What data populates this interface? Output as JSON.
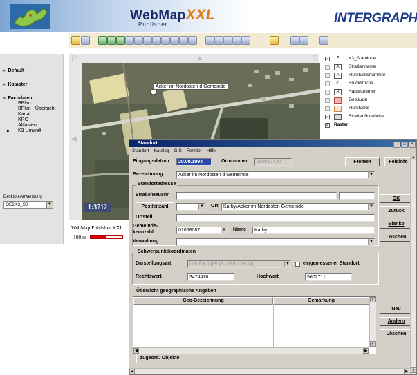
{
  "banner": {
    "product_name": "WebMap",
    "product_suffix": "XXL",
    "product_sub": "Publisher",
    "company": "INTERGRAPH"
  },
  "left_panel": {
    "groups": [
      "Default",
      "Kataster",
      "Fachdaten"
    ],
    "fachdaten_items": [
      "BPlan",
      "BPlan - Übersicht",
      "Kanal",
      "KRO",
      "Altlasten",
      "K3 Umwelt"
    ],
    "desktop_label": "Desktop-Anwendung",
    "desktop_value": "OE2K3_S0"
  },
  "map": {
    "callout": "Acker im Nordosten d Gemeinde",
    "scale": "1:3712",
    "footer": "WebMap Publisher XXL",
    "distance": "100 m"
  },
  "legend": {
    "items": [
      {
        "label": "K3_Standorte",
        "checked": true
      },
      {
        "label": "Straßenname",
        "checked": false
      },
      {
        "label": "Flurstücksnummer",
        "checked": false
      },
      {
        "label": "Bruckstriche",
        "checked": false
      },
      {
        "label": "Hausnummer",
        "checked": false
      },
      {
        "label": "Gebäude",
        "checked": false
      },
      {
        "label": "Flurstücke",
        "checked": false
      },
      {
        "label": "Straßenflurstücke",
        "checked": true
      },
      {
        "label": "Raster",
        "checked": true
      }
    ]
  },
  "dialog": {
    "title": "Standort",
    "menu": [
      "Standort",
      "Katalog",
      "GIS",
      "Fenster",
      "Hilfe"
    ],
    "eingangsdatum_label": "Eingangsdatum",
    "eingangsdatum": "20.09.1994",
    "ortnummer_label": "Ortnummer",
    "ortnummer": "990017420",
    "freitext_button": "Freitext",
    "feldinfo_button": "Feldinfo",
    "bezeichnung_label": "Bezeichnung",
    "bezeichnung": "Acker im Nordosten d Gemeinde",
    "standortadresse_title": "Standortadresse",
    "strasse_label": "Straße/Hausnr",
    "strasse": "",
    "postleitzahl_button": "Postleitzahl",
    "ort_label": "Ort",
    "ort": "Karby/Acker im Nordosten Gemeinde",
    "ortsteil_label": "Ortsteil",
    "ortsteil": "",
    "gemeindekennzahl_label_1": "Gemeinde-",
    "gemeindekennzahl_label_2": "kennzahl",
    "gemeindekennzahl": "01058087",
    "name_label": "Name",
    "name": "Karby",
    "verwaltung_label": "Verwaltung",
    "verwaltung": "",
    "schwerpunkt_title": "Schwerpunktkoordinaten",
    "darstellungsart_label": "Darstellungsart",
    "darstellungsart": "Gauß-Krüger [3 Grad, DHDN]",
    "eingemessen_label": "eingemessener Standort",
    "rechtswert_label": "Rechtswert",
    "rechtswert": "3474476",
    "hochwert_label": "Hochwert",
    "hochwert": "5602711",
    "geo_title": "Übersicht geographische Angaben",
    "col_geo": "Geo-Bezeichnung",
    "col_gemarkung": "Gemarkung",
    "ok_button": "OK",
    "zurueck_button": "Zurück",
    "blanko_button": "Blanko",
    "loeschen_button": "Löschen",
    "neu_button": "Neu",
    "aendern_button": "Ändern",
    "loeschen2_button": "Löschen",
    "tab_label": "zugeord. Objekte"
  }
}
